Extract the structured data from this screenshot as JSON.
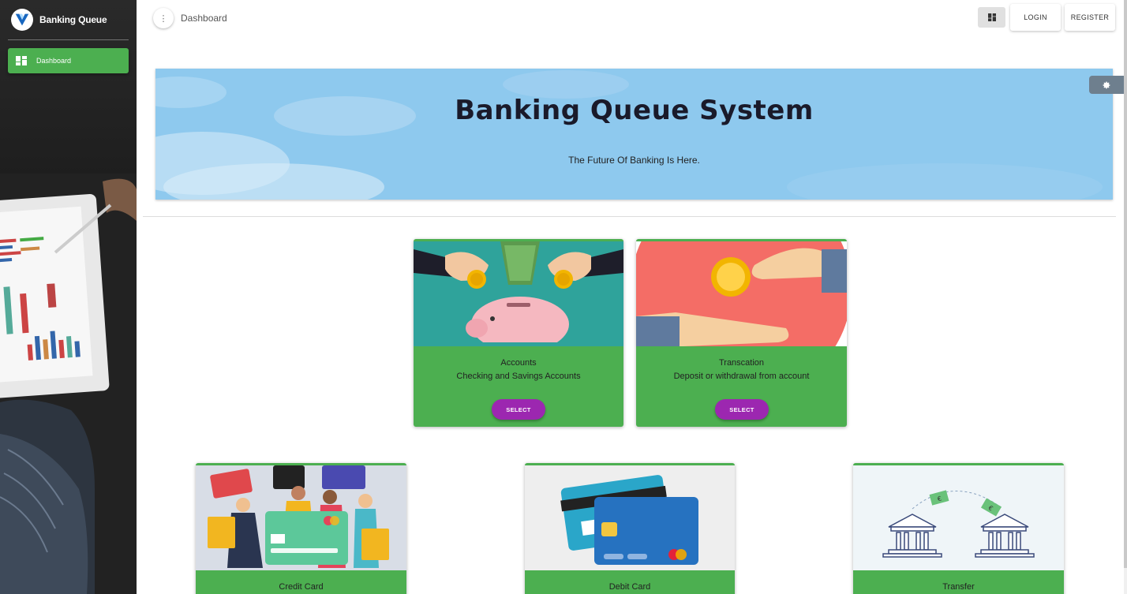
{
  "app": {
    "name": "Banking Queue"
  },
  "sidebar": {
    "items": [
      {
        "label": "Dashboard",
        "icon": "dashboard-icon",
        "active": true
      }
    ]
  },
  "topbar": {
    "breadcrumb": "Dashboard",
    "login_label": "LOGIN",
    "register_label": "REGISTER",
    "view_icon": "dashboard-icon",
    "menu_icon": "vertical-dots-icon"
  },
  "banner": {
    "title": "Banking Queue System",
    "subtitle": "The Future Of Banking Is Here.",
    "settings_icon": "gear-icon"
  },
  "cards": [
    {
      "title": "Accounts",
      "description": "Checking and Savings Accounts",
      "button": "SELECT",
      "image": "piggy-bank-illustration"
    },
    {
      "title": "Transcation",
      "description": "Deposit or withdrawal from account",
      "button": "SELECT",
      "image": "coin-handover-illustration"
    },
    {
      "title": "Credit Card",
      "image": "credit-card-shoppers-illustration"
    },
    {
      "title": "Debit Card",
      "image": "debit-cards-illustration"
    },
    {
      "title": "Transfer",
      "image": "bank-transfer-illustration",
      "image_text_1": "€",
      "image_text_2": "€"
    }
  ],
  "colors": {
    "accent_green": "#4caf50",
    "button_purple": "#9c27b0",
    "banner_sky": "#8ec9ee"
  }
}
